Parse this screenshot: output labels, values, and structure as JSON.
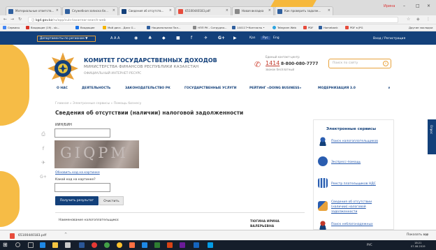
{
  "browser": {
    "tabs": [
      {
        "label": "Материальные ответств...",
        "color": "#2f5f9e"
      },
      {
        "label": "Служебная записка бе...",
        "color": "#2f5f9e"
      },
      {
        "label": "Сведения об отсутств...",
        "color": "#13407a"
      },
      {
        "label": "65100440183.pdf",
        "color": "#e74c3c"
      },
      {
        "label": "Новая вкладка",
        "color": "#888888"
      },
      {
        "label": "Как проверить задолж...",
        "color": "#2f5f9e"
      }
    ],
    "profile": "Ирина",
    "url_domain": "kgd.gov.kz",
    "url_path": "/ru/app/culs-taxarrear-search-web",
    "bookmarks": [
      {
        "label": "Сервисы",
        "color": "#4285f4"
      },
      {
        "label": "Входящие (19) - sb...",
        "color": "#d93025"
      },
      {
        "label": "Входящие",
        "color": "#1a73e8"
      },
      {
        "label": "Мой диск - Диск G...",
        "color": "#f4b400"
      },
      {
        "label": "Национальная Пал...",
        "color": "#2f5f9e"
      },
      {
        "label": "НПП РК - Сотрудни...",
        "color": "#888888"
      },
      {
        "label": "140117•Контакты •",
        "color": "#2f5f9e"
      },
      {
        "label": "Telegram Web",
        "color": "#2ca5e0"
      },
      {
        "label": "PDF",
        "color": "#e74c3c"
      },
      {
        "label": "Homebank",
        "color": "#2f5f9e"
      },
      {
        "label": "PDF в JPG",
        "color": "#e74c3c"
      }
    ],
    "other_bookmarks": "Другие закладки"
  },
  "topbar": {
    "region": "Департаменты по регионам ▼",
    "font_controls": "A A A",
    "langs": [
      "Қаз",
      "Рус",
      "Eng"
    ],
    "current_lang": "Рус",
    "login": "Вход / Регистрация"
  },
  "header": {
    "org_name": "КОМИТЕТ ГОСУДАРСТВЕННЫХ ДОХОДОВ",
    "ministry": "МИНИСТЕРСТВА ФИНАНСОВ РЕСПУБЛИКИ КАЗАХСТАН",
    "official": "ОФИЦИАЛЬНЫЙ ИНТЕРНЕТ-РЕСУРС",
    "contact_center_label": "Единый контакт-центр",
    "phone_short": "1414",
    "phone_long": "8-800-080-7777",
    "free_call": "звонок бесплатный",
    "search_placeholder": "Поиск по сайту"
  },
  "nav": [
    "О НАС",
    "ДЕЯТЕЛЬНОСТЬ",
    "ЗАКОНОДАТЕЛЬСТВО РК",
    "ГОСУДАРСТВЕННЫЕ УСЛУГИ",
    "РЕЙТИНГ «DOING BUSINESS»",
    "МОДЕРНИЗАЦИЯ 3.0",
    "∨"
  ],
  "breadcrumb": "Главная » Электронные сервисы » Помощь бизнесу",
  "form": {
    "title": "Сведения об отсутствии (наличии) налоговой задолженности",
    "inn_label": "ИИН/БИН",
    "captcha_text": "GIQPM",
    "get_code_link": "Обновить код на картинке",
    "captcha_label": "Какой код на картинке?",
    "submit_label": "Получить результат",
    "clear_label": "Очистить"
  },
  "result": {
    "label": "Наименование налогоплательщика:",
    "value": "ТЮГИНА ИРИНА ВАЛЕРЬЕВНА"
  },
  "sidebar": {
    "title": "Электронные сервисы",
    "items": [
      {
        "label": "Поиск налогоплательщиков",
        "icon": "person-icon"
      },
      {
        "label": "Экспресс-помощь",
        "icon": "help-icon"
      },
      {
        "label": "Реестр плательщиков НДС",
        "icon": "building-icon"
      },
      {
        "label": "Сведения об отсутствии (наличии) налоговой задолженности",
        "icon": "handshake-icon"
      },
      {
        "label": "Поиск неблагонадежных",
        "icon": "person-icon"
      }
    ]
  },
  "feedback": "Опрос",
  "download": {
    "file": "65100440183.pdf",
    "show_all": "Показать все"
  },
  "taskbar": {
    "lang": "РУС",
    "time": "18:21",
    "date": "07.08.2019"
  }
}
